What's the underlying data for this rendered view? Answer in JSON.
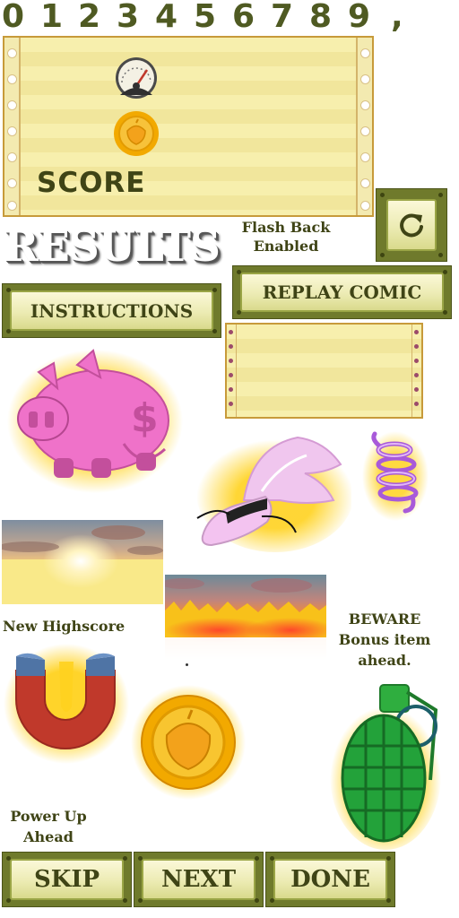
{
  "font_strip": {
    "glyphs": [
      "0",
      "1",
      "2",
      "3",
      "4",
      "5",
      "6",
      "7",
      "8",
      "9",
      ","
    ]
  },
  "score_panel": {
    "label": "SCORE",
    "icons": [
      "speedometer-icon",
      "acorn-coin-icon"
    ]
  },
  "results_title": "RESULTS",
  "flash_back": {
    "line1": "Flash Back",
    "line2": "Enabled"
  },
  "buttons": {
    "replay_icon": "circular-arrow-icon",
    "instructions": "INSTRUCTIONS",
    "replay_comic": "REPLAY COMIC",
    "skip": "SKIP",
    "next": "NEXT",
    "done": "DONE"
  },
  "captions": {
    "new_highscore": "New Highscore",
    "beware_line1": "BEWARE",
    "beware_line2": "Bonus item",
    "beware_line3": "ahead.",
    "powerup_line1": "Power Up",
    "powerup_line2": "Ahead"
  },
  "sprites": [
    "piggy-bank-icon",
    "winged-shoe-icon",
    "spring-icon",
    "magnet-icon",
    "acorn-coin-icon",
    "grenade-icon",
    "sunset-sky-image",
    "fire-sky-image"
  ],
  "colors": {
    "text_olive": "#3f4416",
    "panel_yellow": "#f7efad",
    "button_olive": "#6f7a2c",
    "glow": "#ffd21f"
  }
}
